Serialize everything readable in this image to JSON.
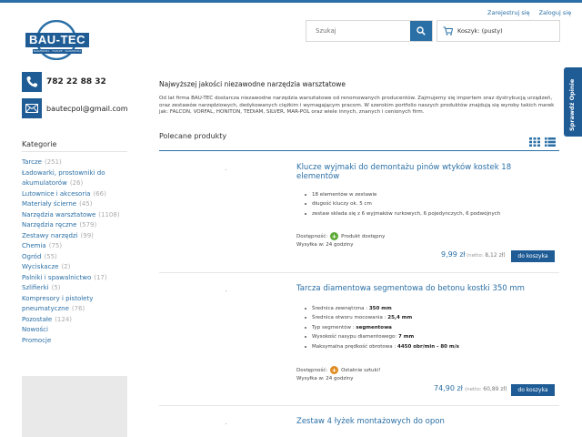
{
  "header": {
    "register": "Zarejestruj się",
    "login": "Zaloguj się",
    "search_placeholder": "Szukaj",
    "cart_label": "Koszyk: (pusty)"
  },
  "logo": {
    "brand": "BAU-TEC",
    "tagline": "NARZĘDZIA · TARCZE · NARZĘDZIA"
  },
  "contact": {
    "phone": "782 22 88 32",
    "email": "bautecpol@gmail.com"
  },
  "side_tab": "Sprawdź Opinie",
  "categories_title": "Kategorie",
  "categories": [
    {
      "label": "Tarcze",
      "count": "(251)"
    },
    {
      "label": "Ładowarki, prostowniki do",
      "count": ""
    },
    {
      "label": "akumulatorów",
      "count": "(26)"
    },
    {
      "label": "Lutownice i akcesoria",
      "count": "(66)"
    },
    {
      "label": "Materiały ścierne",
      "count": "(45)"
    },
    {
      "label": "Narzędzia warsztatowe",
      "count": "(1108)"
    },
    {
      "label": "Narzędzia ręczne",
      "count": "(579)"
    },
    {
      "label": "Zestawy narzędzi",
      "count": "(99)"
    },
    {
      "label": "Chemia",
      "count": "(75)"
    },
    {
      "label": "Ogród",
      "count": "(55)"
    },
    {
      "label": "Wyciskacze",
      "count": "(2)"
    },
    {
      "label": "Palniki i spawalnictwo",
      "count": "(17)"
    },
    {
      "label": "Szlifierki",
      "count": "(5)"
    },
    {
      "label": "Kompresory i pistolety",
      "count": ""
    },
    {
      "label": "pneumatyczne",
      "count": "(76)"
    },
    {
      "label": "Pozostałe",
      "count": "(124)"
    },
    {
      "label": "Nowości",
      "count": ""
    },
    {
      "label": "Promocje",
      "count": ""
    }
  ],
  "headline": "Najwyższej jakości niezawodne narzędzia warsztatowe",
  "intro": "Od lat firma BAU-TEC dostarcza niezawodne narzędzia warsztatowe od renomowanych producentów. Zajmujemy się importem oraz dystrybucją urządzeń, oraz zestawów narzędziowych, dedykowanych ciężkim i wymagającym pracom. W szerokim portfolio naszych produktów znajdują się wyroby takich marek jak: FALCON, VORFAL, HONITON, TEDIAM, SILVER, MAR-POL oraz wiele innych, znanych i cenionych firm.",
  "featured_title": "Polecane produkty",
  "products": [
    {
      "name": "Klucze wyjmaki do demontażu pinów wtyków kostek 18 elementów",
      "features": [
        {
          "text": "18 elementów w zestawie",
          "strong": ""
        },
        {
          "text": "długość kluczy ok. 5 cm",
          "strong": ""
        },
        {
          "text": "zestaw składa się z 6 wyjmaków rurkowych, 6 pojedynczych, 6 podwójnych",
          "strong": ""
        }
      ],
      "availability_label": "Dostępność:",
      "availability": "Produkt dostępny",
      "availability_color": "#5aa832",
      "shipping": "Wysyłka w: 24 godziny",
      "price": "9,99 zł",
      "netto_label": "(netto:",
      "netto_value": "8,12 zł)",
      "buy_label": "do koszyka"
    },
    {
      "name": "Tarcza diamentowa segmentowa do betonu kostki 350 mm",
      "features": [
        {
          "text": "Średnica zewnętrzna : ",
          "strong": "350 mm"
        },
        {
          "text": "Średnica otworu mocowania : ",
          "strong": "25,4 mm"
        },
        {
          "text": "Typ segmentów : ",
          "strong": "segmentowa"
        },
        {
          "text": "Wysokość nasypu diamentowego: ",
          "strong": "7 mm"
        },
        {
          "text": "Maksymalna prędkość obrotowa : ",
          "strong": "4450 obr/min - 80 m/s"
        }
      ],
      "availability_label": "Dostępność:",
      "availability": "Ostatnie sztuki!",
      "availability_color": "#e08a1e",
      "shipping": "Wysyłka w: 24 godziny",
      "price": "74,90 zł",
      "netto_label": "(netto:",
      "netto_value": "60,89 zł)",
      "buy_label": "do koszyka"
    },
    {
      "name": "Zestaw 4 łyżek montażowych do opon"
    }
  ],
  "colors": {
    "accent": "#2a6fa6",
    "dark_accent": "#1f5c95"
  }
}
